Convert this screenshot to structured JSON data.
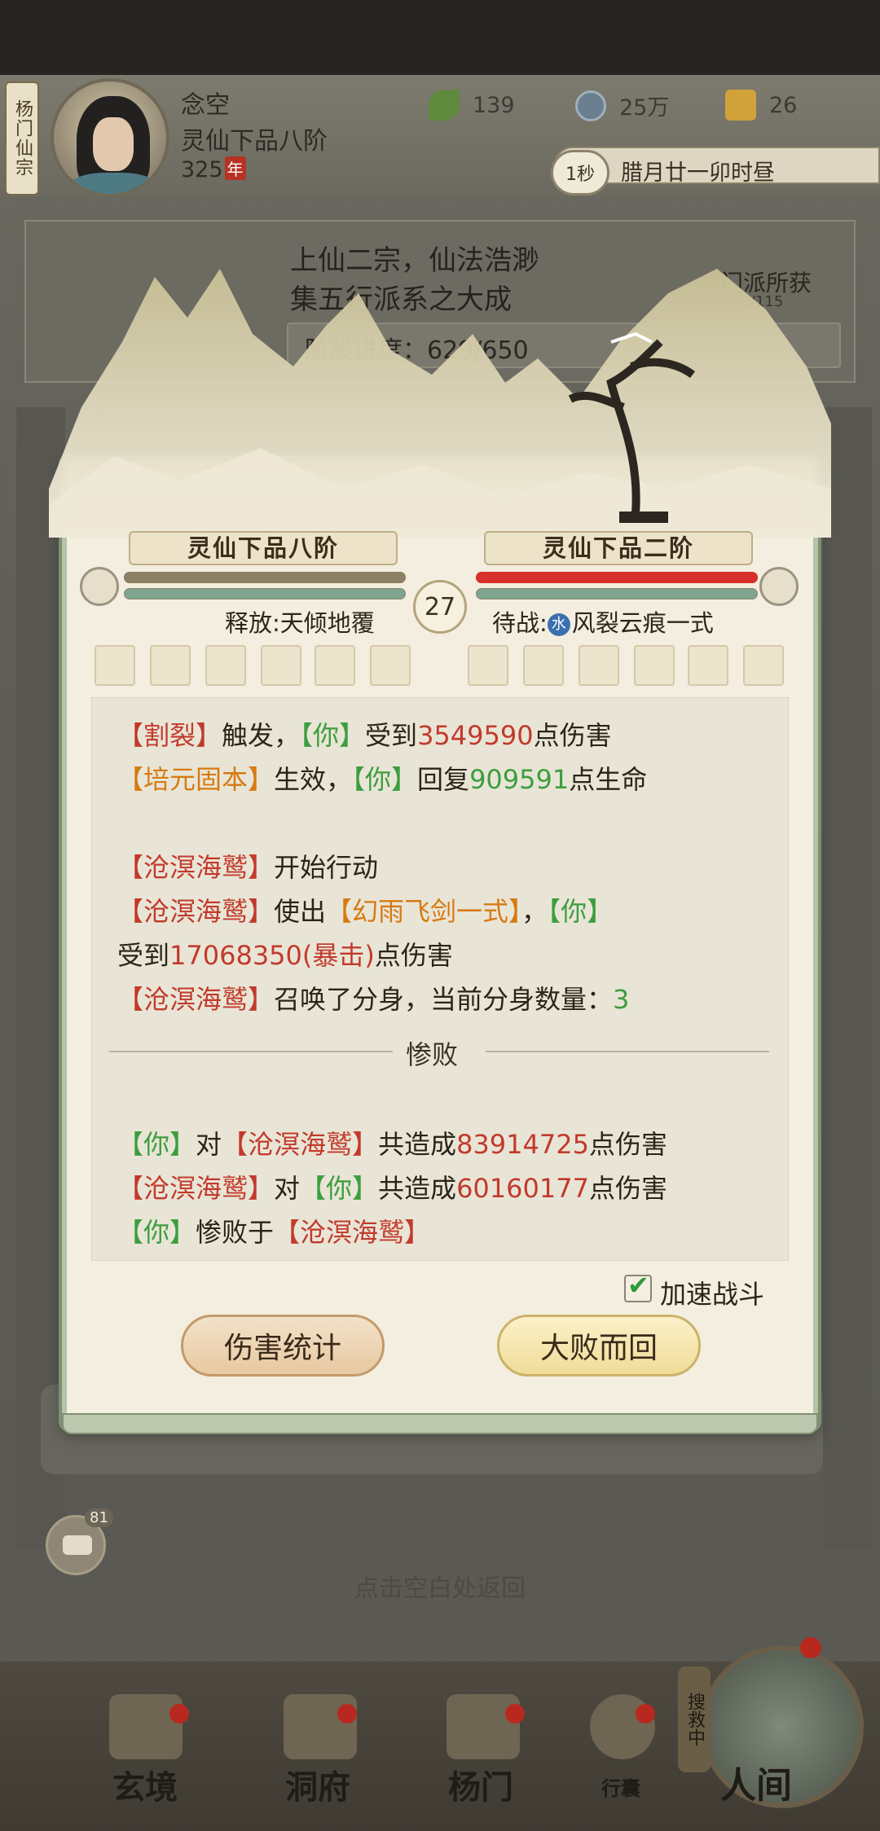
{
  "header": {
    "sect_tab": "杨门仙宗",
    "player_name": "念空",
    "player_rank": "灵仙下品八阶",
    "age": "325",
    "age_unit": "年",
    "resources": [
      {
        "icon": "leaf-icon",
        "value": "139"
      },
      {
        "icon": "coin-icon",
        "value": "25万"
      },
      {
        "icon": "gold-icon",
        "value": "26"
      }
    ],
    "speed": "1秒",
    "time": "腊月廿一卯时昼"
  },
  "banner": {
    "line1": "上仙二宗，仙法浩渺",
    "line2": "集五行派系之大成",
    "progress_label": "阶段进度：629/650",
    "sect_gain": "门派所获",
    "sect_gain_count": "23/115"
  },
  "battle": {
    "left_stage": "灵仙下品八阶",
    "right_stage": "灵仙下品二阶",
    "round": "27",
    "left_hp": 1.0,
    "right_hp": 1.0,
    "left_skill": "释放:天倾地覆",
    "right_skill_prefix": "待战:",
    "right_element": "水",
    "right_skill": "风裂云痕一式",
    "log": {
      "l1": {
        "a": "【割裂】",
        "b": "触发，",
        "c": "【你】",
        "d": "受到",
        "e": "3549590",
        "f": "点伤害"
      },
      "l2": {
        "a": "【培元固本】",
        "b": "生效，",
        "c": "【你】",
        "d": "回复",
        "e": "909591",
        "f": "点生命"
      },
      "l3": {
        "a": "【沧溟海鹫】",
        "b": "开始行动"
      },
      "l4": {
        "a": "【沧溟海鹫】",
        "b": "使出",
        "c": "【幻雨飞剑一式】",
        "d": "，",
        "e": "【你】"
      },
      "l5": {
        "a": "受到",
        "b": "17068350(暴击)",
        "c": "点伤害"
      },
      "l6": {
        "a": "【沧溟海鹫】",
        "b": "召唤了分身，当前分身数量：",
        "c": "3"
      },
      "defeat": "惨败",
      "s1": {
        "a": "【你】",
        "b": "对",
        "c": "【沧溟海鹫】",
        "d": "共造成",
        "e": "83914725",
        "f": "点伤害"
      },
      "s2": {
        "a": "【沧溟海鹫】",
        "b": "对",
        "c": "【你】",
        "d": "共造成",
        "e": "60160177",
        "f": "点伤害"
      },
      "s3": {
        "a": "【你】",
        "b": "惨败于",
        "c": "【沧溟海鹫】"
      }
    },
    "speed_up_label": "加速战斗",
    "damage_stats_button": "伤害统计",
    "retreat_button": "大败而回"
  },
  "background": {
    "chat_count": "81",
    "tap_return": "点击空白处返回"
  },
  "nav": {
    "items": [
      "玄境",
      "洞府",
      "杨门",
      "行囊",
      "人间"
    ],
    "rescue": "搜救中"
  }
}
